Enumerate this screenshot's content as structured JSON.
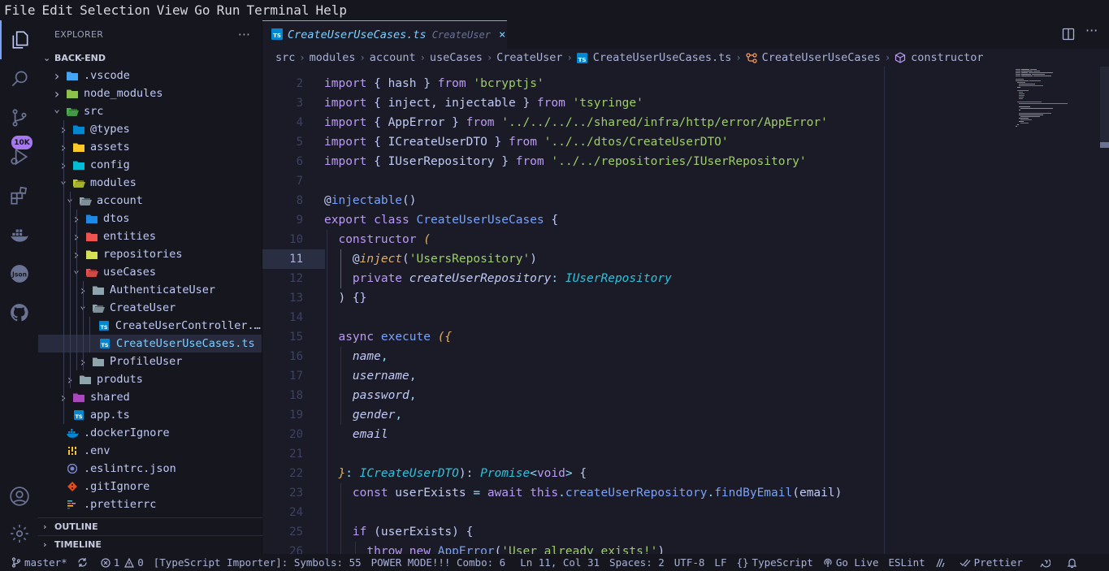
{
  "menu": [
    "File",
    "Edit",
    "Selection",
    "View",
    "Go",
    "Run",
    "Terminal",
    "Help"
  ],
  "activity": {
    "badge": "10K"
  },
  "explorer": {
    "title": "EXPLORER",
    "more": "···",
    "project": "BACK-END",
    "items": [
      {
        "label": ".vscode",
        "depth": 0,
        "type": "folder",
        "chev": "closed",
        "icon": "vscode-folder-icon",
        "color": "#42a5f5"
      },
      {
        "label": "node_modules",
        "depth": 0,
        "type": "folder",
        "chev": "closed",
        "icon": "node-folder-icon",
        "color": "#8bc34a"
      },
      {
        "label": "src",
        "depth": 0,
        "type": "folder",
        "chev": "open",
        "icon": "src-folder-icon",
        "color": "#4caf50"
      },
      {
        "label": "@types",
        "depth": 1,
        "type": "folder",
        "chev": "closed",
        "icon": "types-folder-icon",
        "color": "#0288d1"
      },
      {
        "label": "assets",
        "depth": 1,
        "type": "folder",
        "chev": "closed",
        "icon": "assets-folder-icon",
        "color": "#ffca28"
      },
      {
        "label": "config",
        "depth": 1,
        "type": "folder",
        "chev": "closed",
        "icon": "config-folder-icon",
        "color": "#00bcd4"
      },
      {
        "label": "modules",
        "depth": 1,
        "type": "folder",
        "chev": "open",
        "icon": "modules-folder-icon",
        "color": "#c0ca33"
      },
      {
        "label": "account",
        "depth": 2,
        "type": "folder",
        "chev": "open",
        "icon": "folder-open-icon",
        "color": "#90a4ae"
      },
      {
        "label": "dtos",
        "depth": 3,
        "type": "folder",
        "chev": "closed",
        "icon": "dtos-folder-icon",
        "color": "#1e88e5"
      },
      {
        "label": "entities",
        "depth": 3,
        "type": "folder",
        "chev": "closed",
        "icon": "entities-folder-icon",
        "color": "#ef5350"
      },
      {
        "label": "repositories",
        "depth": 3,
        "type": "folder",
        "chev": "closed",
        "icon": "repositories-folder-icon",
        "color": "#d4e157"
      },
      {
        "label": "useCases",
        "depth": 3,
        "type": "folder",
        "chev": "open",
        "icon": "usecases-folder-icon",
        "color": "#ef5350"
      },
      {
        "label": "AuthenticateUser",
        "depth": 4,
        "type": "folder",
        "chev": "closed",
        "icon": "folder-icon",
        "color": "#90a4ae"
      },
      {
        "label": "CreateUser",
        "depth": 4,
        "type": "folder",
        "chev": "open",
        "icon": "folder-open-icon",
        "color": "#90a4ae"
      },
      {
        "label": "CreateUserController.ts",
        "depth": 5,
        "type": "file",
        "chev": "",
        "icon": "typescript-file-icon",
        "color": "#0288d1"
      },
      {
        "label": "CreateUserUseCases.ts",
        "depth": 5,
        "type": "file",
        "chev": "",
        "icon": "typescript-file-icon",
        "color": "#0288d1",
        "selected": true
      },
      {
        "label": "ProfileUser",
        "depth": 4,
        "type": "folder",
        "chev": "closed",
        "icon": "folder-icon",
        "color": "#90a4ae"
      },
      {
        "label": "produts",
        "depth": 2,
        "type": "folder",
        "chev": "closed",
        "icon": "folder-icon",
        "color": "#90a4ae"
      },
      {
        "label": "shared",
        "depth": 1,
        "type": "folder",
        "chev": "closed",
        "icon": "shared-folder-icon",
        "color": "#ab47bc"
      },
      {
        "label": "app.ts",
        "depth": 1,
        "type": "file",
        "chev": "",
        "icon": "typescript-file-icon",
        "color": "#0288d1"
      },
      {
        "label": ".dockerIgnore",
        "depth": 0,
        "type": "file",
        "chev": "",
        "icon": "docker-file-icon",
        "color": "#0288d1"
      },
      {
        "label": ".env",
        "depth": 0,
        "type": "file",
        "chev": "",
        "icon": "env-file-icon",
        "color": "#fbc02d"
      },
      {
        "label": ".eslintrc.json",
        "depth": 0,
        "type": "file",
        "chev": "",
        "icon": "eslint-file-icon",
        "color": "#7986cb"
      },
      {
        "label": ".gitIgnore",
        "depth": 0,
        "type": "file",
        "chev": "",
        "icon": "git-file-icon",
        "color": "#e64a19"
      },
      {
        "label": ".prettierrc",
        "depth": 0,
        "type": "file",
        "chev": "",
        "icon": "prettier-file-icon",
        "color": "#56b3b4"
      }
    ],
    "outline": "OUTLINE",
    "timeline": "TIMELINE"
  },
  "tab": {
    "name": "CreateUserUseCases.ts",
    "description": "CreateUser",
    "close": "×"
  },
  "breadcrumb": [
    "src",
    "modules",
    "account",
    "useCases",
    "CreateUser",
    "CreateUserUseCases.ts",
    "CreateUserUseCases",
    "constructor"
  ],
  "editor": {
    "current_line": 11,
    "lines": [
      {
        "n": "2",
        "tokens": [
          [
            "kw",
            "import"
          ],
          [
            "plain",
            " { hash } "
          ],
          [
            "kw",
            "from"
          ],
          [
            "plain",
            " "
          ],
          [
            "str",
            "'bcryptjs'"
          ]
        ]
      },
      {
        "n": "3",
        "tokens": [
          [
            "kw",
            "import"
          ],
          [
            "plain",
            " { inject, injectable } "
          ],
          [
            "kw",
            "from"
          ],
          [
            "plain",
            " "
          ],
          [
            "str",
            "'tsyringe'"
          ]
        ]
      },
      {
        "n": "4",
        "tokens": [
          [
            "kw",
            "import"
          ],
          [
            "plain",
            " { AppError } "
          ],
          [
            "kw",
            "from"
          ],
          [
            "plain",
            " "
          ],
          [
            "str",
            "'../../../../shared/infra/http/error/AppError'"
          ]
        ]
      },
      {
        "n": "5",
        "tokens": [
          [
            "kw",
            "import"
          ],
          [
            "plain",
            " { ICreateUserDTO } "
          ],
          [
            "kw",
            "from"
          ],
          [
            "plain",
            " "
          ],
          [
            "str",
            "'../../dtos/CreateUserDTO'"
          ]
        ]
      },
      {
        "n": "6",
        "tokens": [
          [
            "kw",
            "import"
          ],
          [
            "plain",
            " { IUserRepository } "
          ],
          [
            "kw",
            "from"
          ],
          [
            "plain",
            " "
          ],
          [
            "str",
            "'../../repositories/IUserRepository'"
          ]
        ]
      },
      {
        "n": "7",
        "tokens": []
      },
      {
        "n": "8",
        "tokens": [
          [
            "deco",
            "@"
          ],
          [
            "fn",
            "injectable"
          ],
          [
            "plain",
            "()"
          ]
        ]
      },
      {
        "n": "9",
        "tokens": [
          [
            "kw",
            "export"
          ],
          [
            "plain",
            " "
          ],
          [
            "kw",
            "class"
          ],
          [
            "plain",
            " "
          ],
          [
            "cls",
            "CreateUserUseCases"
          ],
          [
            "plain",
            " {"
          ]
        ]
      },
      {
        "n": "10",
        "tokens": [
          [
            "plain",
            "  "
          ],
          [
            "kw",
            "constructor"
          ],
          [
            "plain",
            " "
          ],
          [
            "param",
            "("
          ]
        ]
      },
      {
        "n": "11",
        "tokens": [
          [
            "plain",
            "    "
          ],
          [
            "deco",
            "@"
          ],
          [
            "param",
            "inject"
          ],
          [
            "plain",
            "("
          ],
          [
            "str",
            "'UsersRepository'"
          ],
          [
            "plain",
            ")"
          ]
        ]
      },
      {
        "n": "12",
        "tokens": [
          [
            "plain",
            "    "
          ],
          [
            "kw",
            "private"
          ],
          [
            "plain",
            " "
          ],
          [
            "var",
            "createUserRepository"
          ],
          [
            "punc",
            ": "
          ],
          [
            "type",
            "IUserRepository"
          ]
        ]
      },
      {
        "n": "13",
        "tokens": [
          [
            "plain",
            "  ) {}"
          ]
        ]
      },
      {
        "n": "14",
        "tokens": []
      },
      {
        "n": "15",
        "tokens": [
          [
            "plain",
            "  "
          ],
          [
            "kw",
            "async"
          ],
          [
            "plain",
            " "
          ],
          [
            "fn",
            "execute"
          ],
          [
            "plain",
            " "
          ],
          [
            "param",
            "({"
          ]
        ]
      },
      {
        "n": "16",
        "tokens": [
          [
            "plain",
            "    "
          ],
          [
            "var",
            "name"
          ],
          [
            "punc",
            ","
          ]
        ]
      },
      {
        "n": "17",
        "tokens": [
          [
            "plain",
            "    "
          ],
          [
            "var",
            "username"
          ],
          [
            "punc",
            ","
          ]
        ]
      },
      {
        "n": "18",
        "tokens": [
          [
            "plain",
            "    "
          ],
          [
            "var",
            "password"
          ],
          [
            "punc",
            ","
          ]
        ]
      },
      {
        "n": "19",
        "tokens": [
          [
            "plain",
            "    "
          ],
          [
            "var",
            "gender"
          ],
          [
            "punc",
            ","
          ]
        ]
      },
      {
        "n": "20",
        "tokens": [
          [
            "plain",
            "    "
          ],
          [
            "var",
            "email"
          ]
        ]
      },
      {
        "n": "21",
        "tokens": []
      },
      {
        "n": "22",
        "tokens": [
          [
            "plain",
            "  "
          ],
          [
            "param",
            "}"
          ],
          [
            "punc",
            ": "
          ],
          [
            "type",
            "ICreateUserDTO"
          ],
          [
            "plain",
            "): "
          ],
          [
            "type",
            "Promise"
          ],
          [
            "punc",
            "<"
          ],
          [
            "kw",
            "void"
          ],
          [
            "punc",
            ">"
          ],
          [
            "plain",
            " {"
          ]
        ]
      },
      {
        "n": "23",
        "tokens": [
          [
            "plain",
            "    "
          ],
          [
            "kw",
            "const"
          ],
          [
            "plain",
            " userExists "
          ],
          [
            "punc",
            "="
          ],
          [
            "plain",
            " "
          ],
          [
            "kw",
            "await"
          ],
          [
            "plain",
            " "
          ],
          [
            "kw",
            "this"
          ],
          [
            "punc",
            "."
          ],
          [
            "fn",
            "createUserRepository"
          ],
          [
            "punc",
            "."
          ],
          [
            "fn",
            "findByEmail"
          ],
          [
            "plain",
            "(email)"
          ]
        ]
      },
      {
        "n": "24",
        "tokens": []
      },
      {
        "n": "25",
        "tokens": [
          [
            "plain",
            "    "
          ],
          [
            "kw",
            "if"
          ],
          [
            "plain",
            " (userExists) {"
          ]
        ]
      },
      {
        "n": "26",
        "tokens": [
          [
            "plain",
            "      "
          ],
          [
            "kw",
            "throw"
          ],
          [
            "plain",
            " "
          ],
          [
            "kw",
            "new"
          ],
          [
            "plain",
            " "
          ],
          [
            "cls",
            "AppError"
          ],
          [
            "plain",
            "("
          ],
          [
            "str",
            "'User already exists!'"
          ],
          [
            "plain",
            ")"
          ]
        ]
      }
    ]
  },
  "status": {
    "branch": "master*",
    "errors": "1",
    "warnings": "0",
    "importer": "[TypeScript Importer]: Symbols: 55",
    "power": "POWER MODE!!! Combo: 6",
    "position": "Ln 11, Col 31",
    "spaces": "Spaces: 2",
    "encoding": "UTF-8",
    "eol": "LF",
    "language": "TypeScript",
    "golive": "Go Live",
    "eslint": "ESLint",
    "prettier": "Prettier"
  }
}
